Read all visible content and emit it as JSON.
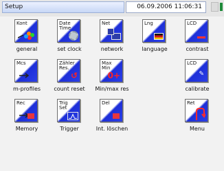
{
  "header": {
    "title": "Setup",
    "datetime": "06.09.2006 11:06:31"
  },
  "tiles": [
    {
      "line1": "Kont",
      "line2": "",
      "caption": "general",
      "icon": "contrast-palette-icon"
    },
    {
      "line1": "Date",
      "line2": "Time",
      "caption": "set clock",
      "icon": "clock-gear-icon"
    },
    {
      "line1": "Net",
      "line2": "",
      "caption": "network",
      "icon": "network-computer-icon"
    },
    {
      "line1": "Lng",
      "line2": "",
      "caption": "language",
      "icon": "language-flag-icon"
    },
    {
      "line1": "LCD",
      "line2": "",
      "caption": "contrast",
      "icon": "lcd-contrast-icon"
    },
    {
      "line1": "Mcs",
      "line2": "",
      "caption": "m-profiles",
      "icon": "measurement-profiles-icon"
    },
    {
      "line1": "Zähler",
      "line2": "Res.",
      "caption": "count reset",
      "icon": "counter-reset-icon"
    },
    {
      "line1": "Max",
      "line2": "Min",
      "caption": "Min/max res",
      "icon": "minmax-reset-icon"
    },
    {
      "line1": "LCD",
      "line2": "",
      "caption": "calibrate",
      "icon": "lcd-calibrate-icon"
    },
    {
      "line1": "Rec",
      "line2": "",
      "caption": "Memory",
      "icon": "memory-record-icon"
    },
    {
      "line1": "Trig",
      "line2": "Set",
      "caption": "Trigger",
      "icon": "trigger-icon"
    },
    {
      "line1": "Del",
      "line2": "",
      "caption": "Int. löschen",
      "icon": "delete-internal-icon"
    },
    {
      "line1": "Ret",
      "line2": "",
      "caption": "Menu",
      "icon": "return-menu-icon"
    }
  ],
  "colors": {
    "accent": "#1d2fd8",
    "status": "#1f8a3a",
    "glyph": "#ff2222"
  }
}
